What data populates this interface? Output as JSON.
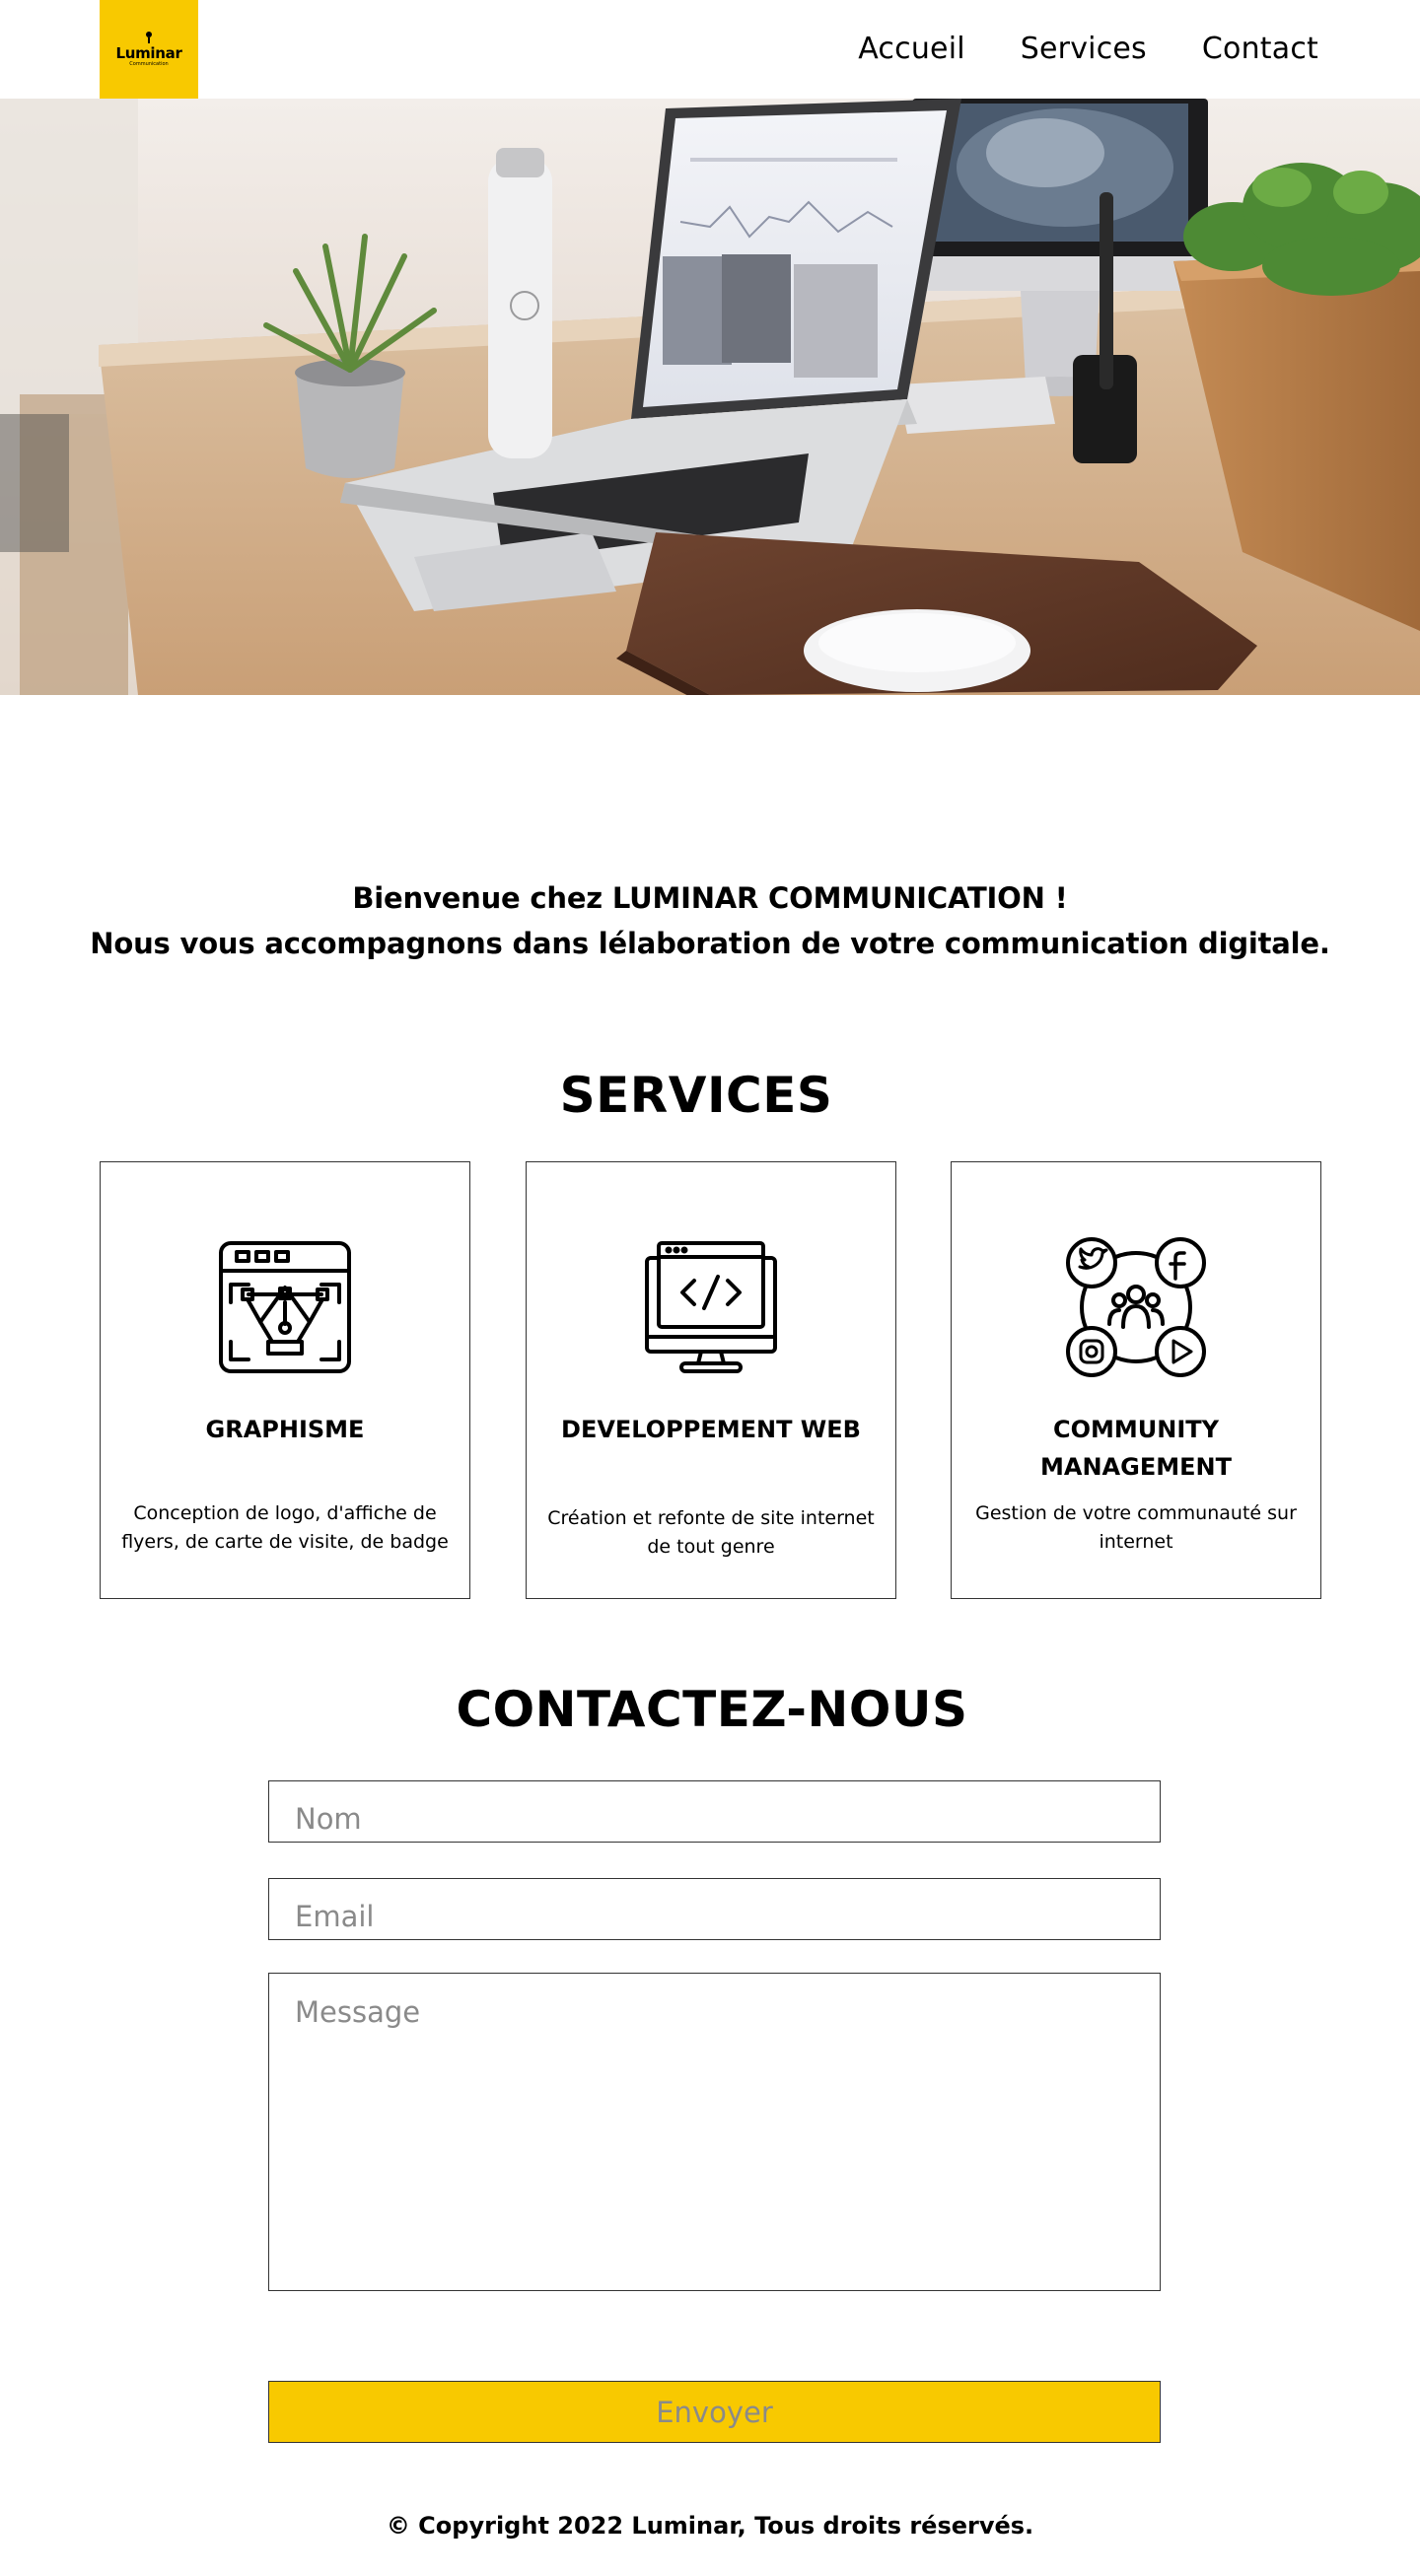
{
  "header": {
    "logo": {
      "name": "Luminar",
      "tagline": "Communication"
    },
    "nav": [
      {
        "label": "Accueil"
      },
      {
        "label": "Services"
      },
      {
        "label": "Contact"
      }
    ]
  },
  "colors": {
    "accent": "#f8c900",
    "text": "#000000",
    "border": "#333333",
    "placeholder": "#8a8a8a"
  },
  "intro": {
    "line1": "Bienvenue chez LUMINAR COMMUNICATION !",
    "line2": "Nous vous accompagnons dans lélaboration de votre communication digitale."
  },
  "services": {
    "title": "SERVICES",
    "cards": [
      {
        "icon": "pen-tool-window-icon",
        "title": "GRAPHISME",
        "description": "Conception de logo, d'affiche de flyers, de carte de visite, de badge"
      },
      {
        "icon": "code-monitor-icon",
        "title": "DEVELOPPEMENT WEB",
        "description": "Création et refonte de site internet de tout genre"
      },
      {
        "icon": "social-network-icon",
        "title": "COMMUNITY MANAGEMENT",
        "description": "Gestion de votre communauté sur internet"
      }
    ]
  },
  "contact": {
    "title": "CONTACTEZ-NOUS",
    "name_placeholder": "Nom",
    "email_placeholder": "Email",
    "message_placeholder": "Message",
    "submit_label": "Envoyer"
  },
  "footer": {
    "copyright": "© Copyright 2022 Luminar, Tous droits réservés."
  }
}
